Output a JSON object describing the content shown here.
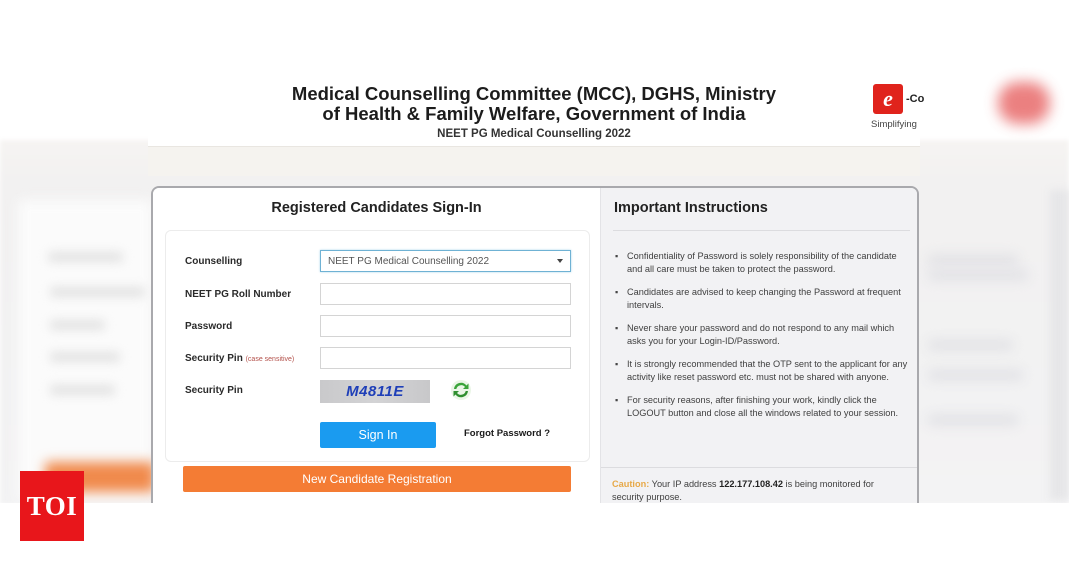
{
  "header": {
    "title_line1": "Medical Counselling Committee (MCC), DGHS, Ministry",
    "title_line2": "of Health & Family Welfare, Government of India",
    "subtitle": "NEET PG Medical Counselling 2022",
    "logo_glyph": "e",
    "logo_suffix": "-Co",
    "logo_tagline": "Simplifying"
  },
  "signin": {
    "title": "Registered Candidates Sign-In",
    "fields": {
      "counselling": {
        "label": "Counselling",
        "value": "NEET PG Medical Counselling 2022"
      },
      "roll_number": {
        "label": "NEET PG Roll Number",
        "value": "",
        "placeholder": ""
      },
      "password": {
        "label": "Password",
        "value": "",
        "placeholder": ""
      },
      "security_pin_input": {
        "label": "Security Pin",
        "hint": "(case sensitive)",
        "value": "",
        "placeholder": ""
      },
      "security_pin_captcha": {
        "label": "Security Pin",
        "captcha_text": "M4811E"
      }
    },
    "signin_button": "Sign In",
    "forgot_password": "Forgot Password ?",
    "register_button": "New Candidate Registration",
    "colors": {
      "signin": "#1a9bf0",
      "register": "#f47c34"
    }
  },
  "instructions": {
    "title": "Important Instructions",
    "items": [
      "Confidentiality of Password is solely responsibility of the candidate and all care must be taken to protect the password.",
      "Candidates are advised to keep changing the Password at frequent intervals.",
      "Never share your password and do not respond to any mail which asks you for your Login-ID/Password.",
      "It is strongly recommended that the OTP sent to the applicant for any activity like reset password etc. must not be shared with anyone.",
      "For security reasons, after finishing your work, kindly click the LOGOUT button and close all the windows related to your session."
    ],
    "caution_label": "Caution:",
    "caution_pre": "Your IP address",
    "ip_address": "122.177.108.42",
    "caution_post": "is being monitored for security purpose."
  },
  "watermark": {
    "text": "TOI",
    "color": "#e8161b"
  }
}
